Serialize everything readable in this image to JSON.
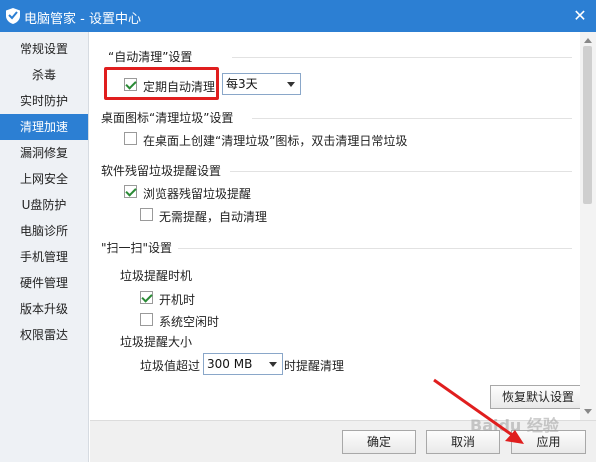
{
  "window": {
    "title": "电脑管家 - 设置中心",
    "logo_icon": "shield-logo-icon",
    "close_icon": "close-icon",
    "accent_color": "#2c7fd3"
  },
  "sidebar": {
    "items": [
      {
        "label": "常规设置",
        "active": false
      },
      {
        "label": "杀毒",
        "active": false
      },
      {
        "label": "实时防护",
        "active": false
      },
      {
        "label": "清理加速",
        "active": true
      },
      {
        "label": "漏洞修复",
        "active": false
      },
      {
        "label": "上网安全",
        "active": false
      },
      {
        "label": "U盘防护",
        "active": false
      },
      {
        "label": "电脑诊所",
        "active": false
      },
      {
        "label": "手机管理",
        "active": false
      },
      {
        "label": "硬件管理",
        "active": false
      },
      {
        "label": "版本升级",
        "active": false
      },
      {
        "label": "权限雷达",
        "active": false
      }
    ]
  },
  "sections": {
    "auto_clean": {
      "title": "“自动清理”设置",
      "checkbox_label": "定期自动清理",
      "checked": true,
      "interval_select": "每3天"
    },
    "desktop_icon": {
      "title": "桌面图标“清理垃圾”设置",
      "checkbox_label": "在桌面上创建“清理垃圾”图标，双击清理日常垃圾",
      "checked": false
    },
    "residual": {
      "title": "软件残留垃圾提醒设置",
      "browser_label": "浏览器残留垃圾提醒",
      "browser_checked": true,
      "no_remind_label": "无需提醒，自动清理",
      "no_remind_checked": false
    },
    "scan": {
      "title": "\"扫一扫\"设置",
      "timing_title": "垃圾提醒时机",
      "on_boot_label": "开机时",
      "on_boot_checked": true,
      "idle_label": "系统空闲时",
      "idle_checked": false,
      "size_title": "垃圾提醒大小",
      "size_prefix": "垃圾值超过",
      "size_select": "300 MB",
      "size_suffix": "时提醒清理"
    }
  },
  "buttons": {
    "restore_default": "恢复默认设置",
    "confirm": "确定",
    "cancel": "取消",
    "apply": "应用"
  },
  "watermark_text": "Baidu 经验",
  "annotation_color": "#e01e1e"
}
